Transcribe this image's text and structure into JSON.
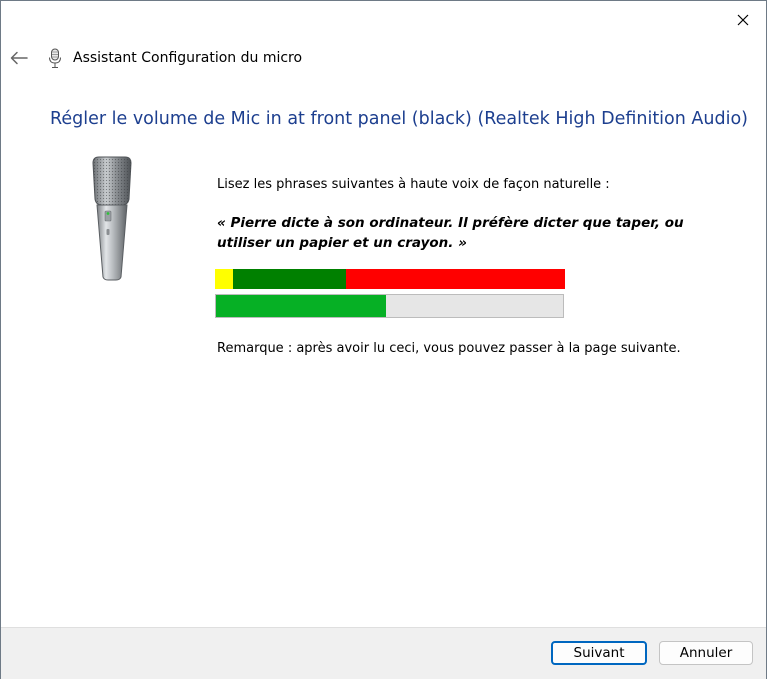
{
  "window": {
    "title": "Assistant Configuration du micro"
  },
  "page": {
    "heading": "Régler le volume de Mic in at front panel (black) (Realtek High Definition Audio)",
    "instruction": "Lisez les phrases suivantes à haute voix de façon naturelle :",
    "quote": "« Pierre dicte à son ordinateur. Il préfère dicter que taper, ou utiliser un papier et un crayon. »",
    "remark": "Remarque : après avoir lu ceci, vous pouvez passer à la page suivante."
  },
  "level_scale": {
    "segments": [
      {
        "name": "low",
        "color": "#ffff00",
        "fraction": 0.05
      },
      {
        "name": "good",
        "color": "#008000",
        "fraction": 0.325
      },
      {
        "name": "high",
        "color": "#ff0000",
        "fraction": 0.625
      }
    ]
  },
  "volume_meter": {
    "level_fraction": 0.49,
    "fill_color": "#06b025"
  },
  "buttons": {
    "next_label": "Suivant",
    "cancel_label": "Annuler"
  },
  "icons": {
    "back": "back-arrow-icon",
    "app": "microphone-icon",
    "close": "close-icon"
  },
  "colors": {
    "heading": "#1d3f8f",
    "accent": "#0067c0"
  }
}
